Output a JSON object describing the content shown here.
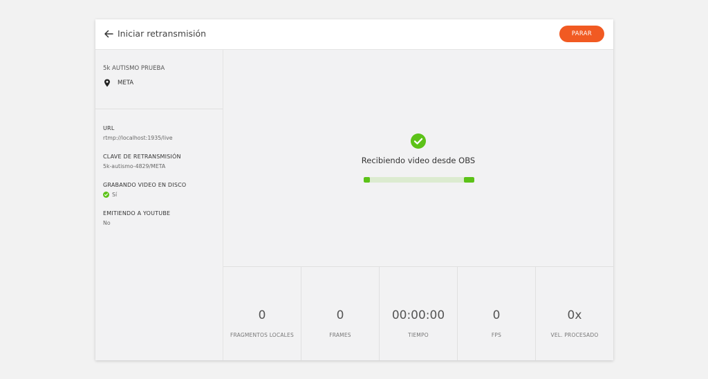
{
  "header": {
    "title": "Iniciar retransmisión",
    "stop_label": "PARAR",
    "accent_color": "#f15a22"
  },
  "sidebar": {
    "event_name": "5k AUTISMO PRUEBA",
    "location": "META",
    "fields": [
      {
        "label": "URL",
        "value": "rtmp://localhost:1935/live"
      },
      {
        "label": "CLAVE DE RETRANSMISIÓN",
        "value": "5k-autismo-4829/META"
      },
      {
        "label": "GRABANDO VIDEO EN DISCO",
        "value": "Sí",
        "icon": "check-circle-icon"
      },
      {
        "label": "EMITIENDO A YOUTUBE",
        "value": "No"
      }
    ]
  },
  "status": {
    "text": "Recibiendo video desde OBS",
    "icon": "check-circle-icon",
    "color": "#5cc218"
  },
  "stats": [
    {
      "value": "0",
      "label": "FRAGMENTOS LOCALES"
    },
    {
      "value": "0",
      "label": "FRAMES"
    },
    {
      "value": "00:00:00",
      "label": "TIEMPO"
    },
    {
      "value": "0",
      "label": "FPS"
    },
    {
      "value": "0x",
      "label": "VEL. PROCESADO"
    }
  ]
}
